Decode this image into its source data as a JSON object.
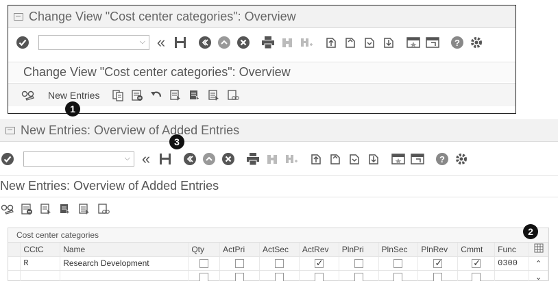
{
  "window1": {
    "title": "Change View \"Cost center categories\": Overview",
    "page_title": "Change View \"Cost center categories\": Overview",
    "new_entries_label": "New Entries",
    "command_field_value": ""
  },
  "window2": {
    "title": "New Entries: Overview of Added Entries",
    "page_title": "New Entries: Overview of Added Entries",
    "command_field_value": "",
    "table": {
      "title": "Cost center categories",
      "columns": [
        "CCtC",
        "Name",
        "Qty",
        "ActPri",
        "ActSec",
        "ActRev",
        "PlnPri",
        "PlnSec",
        "PlnRev",
        "Cmmt",
        "Func"
      ],
      "rows": [
        {
          "cctc": "R",
          "name": "Research Development",
          "qty": false,
          "actpri": false,
          "actsec": false,
          "actrev": true,
          "plnpri": false,
          "plnsec": false,
          "plnrev": true,
          "cmmt": true,
          "func": "0300"
        },
        {
          "cctc": "",
          "name": "",
          "qty": false,
          "actpri": false,
          "actsec": false,
          "actrev": false,
          "plnpri": false,
          "plnsec": false,
          "plnrev": false,
          "cmmt": false,
          "func": ""
        }
      ]
    }
  },
  "callouts": {
    "one": "1",
    "two": "2",
    "three": "3"
  },
  "colors": {
    "title_bg": "#f2f2f2",
    "callout": "#111111",
    "icon": "#555555"
  }
}
